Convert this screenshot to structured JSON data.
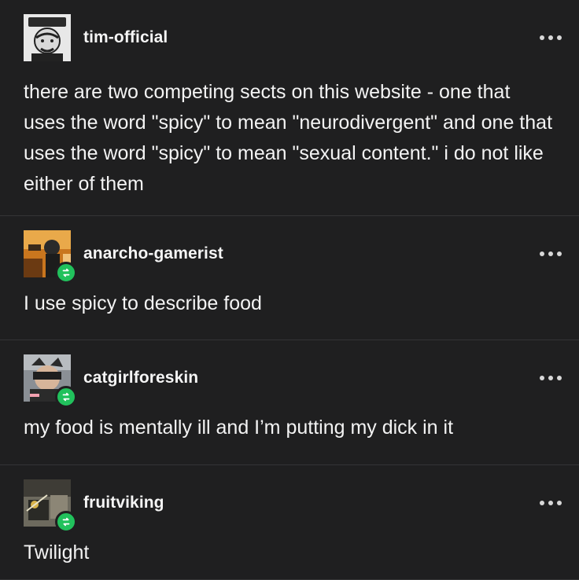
{
  "posts": [
    {
      "username": "tim-official",
      "text": "there are two competing sects on this website - one that uses the word \"spicy\" to mean \"neurodivergent\" and one that uses the word \"spicy\" to mean \"sexual content.\" i do not like either of them",
      "reblog": false
    },
    {
      "username": "anarcho-gamerist",
      "text": "I use spicy to describe food",
      "reblog": true
    },
    {
      "username": "catgirlforeskin",
      "text": "my food is mentally ill and I’m putting my dick in it",
      "reblog": true
    },
    {
      "username": "fruitviking",
      "text": "Twilight",
      "reblog": true
    }
  ],
  "icons": {
    "more": "more-options-icon",
    "reblog": "reblog-icon"
  },
  "colors": {
    "background": "#1f1f20",
    "reblog_badge": "#21c15c",
    "text": "#f3f3f3",
    "divider": "#343436"
  }
}
